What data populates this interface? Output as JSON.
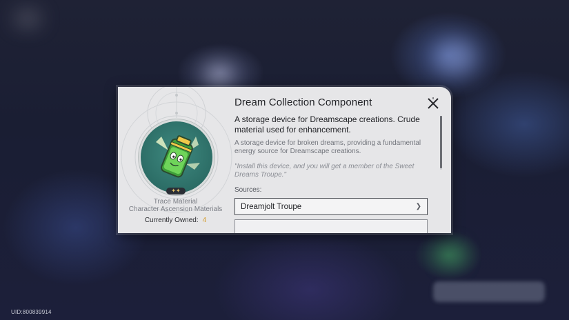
{
  "item": {
    "name": "Dream Collection Component",
    "short_description": "A storage device for Dreamscape creations. Crude material used for enhancement.",
    "description": "A storage device for broken dreams, providing a fundamental energy source for Dreamscape creations.",
    "flavor_text": "\"Install this device, and you will get a member of the Sweet Dreams Troupe.\"",
    "rarity_stars": "✦✦",
    "type": "Trace Material",
    "category": "Character Ascension Materials",
    "owned_label": "Currently Owned:",
    "owned_count": "4"
  },
  "sources": {
    "label": "Sources:",
    "items": [
      {
        "label": "Dreamjolt Troupe"
      }
    ]
  },
  "footer": {
    "uid": "UID:800839914"
  },
  "colors": {
    "accent_owned": "#d49a2a",
    "medallion": "#2c6d66",
    "battery_green": "#5fd14d"
  },
  "icons": {
    "close": "close-icon",
    "source_chevron": "chevron-right-icon",
    "item": "battery-icon"
  }
}
